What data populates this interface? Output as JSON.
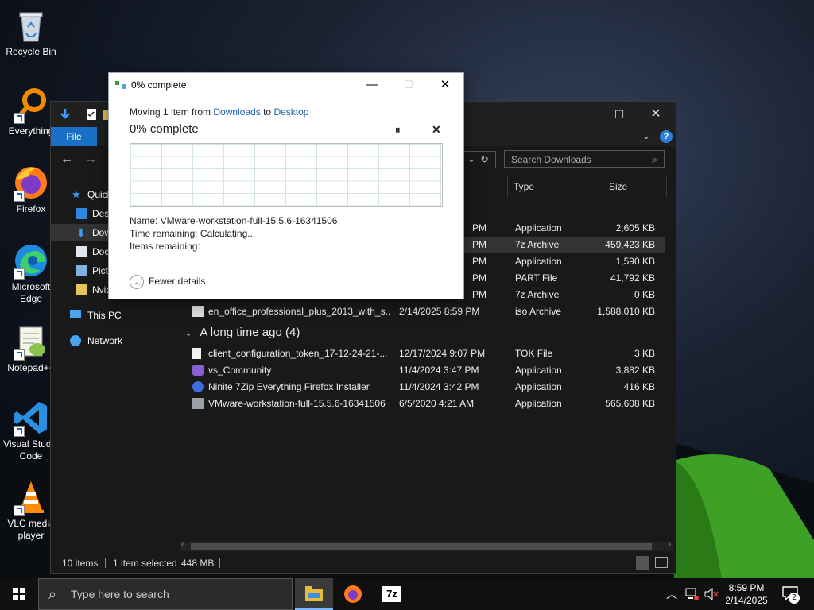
{
  "desktop": {
    "icons": [
      {
        "label": "Recycle Bin",
        "icon": "recycle-bin-icon"
      },
      {
        "label": "Everything",
        "icon": "everything-search-icon"
      },
      {
        "label": "Firefox",
        "icon": "firefox-icon"
      },
      {
        "label": "Microsoft Edge",
        "icon": "edge-icon"
      },
      {
        "label": "Notepad++",
        "icon": "notepad-plus-plus-icon"
      },
      {
        "label": "Visual Studio Code",
        "icon": "vscode-icon"
      },
      {
        "label": "VLC media player",
        "icon": "vlc-icon"
      }
    ]
  },
  "explorer": {
    "file_tab": "File",
    "search_placeholder": "Search Downloads",
    "sidebar": [
      {
        "label": "Quick access",
        "icon": "star-icon"
      },
      {
        "label": "Desktop",
        "icon": "desktop-folder-icon"
      },
      {
        "label": "Downloads",
        "icon": "downloads-folder-icon"
      },
      {
        "label": "Documents",
        "icon": "documents-folder-icon"
      },
      {
        "label": "Pictures",
        "icon": "pictures-folder-icon"
      },
      {
        "label": "Nvidia",
        "icon": "folder-icon"
      },
      {
        "label": "This PC",
        "icon": "this-pc-icon"
      },
      {
        "label": "Network",
        "icon": "network-icon"
      }
    ],
    "columns": {
      "type": "Type",
      "size": "Size"
    },
    "today_rows": [
      {
        "name": "",
        "date": "PM",
        "type": "Application",
        "size": "2,605 KB"
      },
      {
        "name": "",
        "date": "PM",
        "type": "7z Archive",
        "size": "459,423 KB",
        "selected": true
      },
      {
        "name": "",
        "date": "PM",
        "type": "Application",
        "size": "1,590 KB"
      },
      {
        "name": "",
        "date": "PM",
        "type": "PART File",
        "size": "41,792 KB"
      },
      {
        "name": "",
        "date": "PM",
        "type": "7z Archive",
        "size": "0 KB"
      },
      {
        "name": "en_office_professional_plus_2013_with_s...",
        "date": "2/14/2025 8:59 PM",
        "type": "iso Archive",
        "size": "1,588,010 KB"
      }
    ],
    "group_long_ago": "A long time ago (4)",
    "long_ago_rows": [
      {
        "name": "client_configuration_token_17-12-24-21-...",
        "date": "12/17/2024 9:07 PM",
        "type": "TOK File",
        "size": "3 KB"
      },
      {
        "name": "vs_Community",
        "date": "11/4/2024 3:47 PM",
        "type": "Application",
        "size": "3,882 KB"
      },
      {
        "name": "Ninite 7Zip Everything Firefox Installer",
        "date": "11/4/2024 3:42 PM",
        "type": "Application",
        "size": "416 KB"
      },
      {
        "name": "VMware-workstation-full-15.5.6-16341506",
        "date": "6/5/2020 4:21 AM",
        "type": "Application",
        "size": "565,608 KB"
      }
    ],
    "status": {
      "items": "10 items",
      "selected": "1 item selected",
      "size": "448 MB"
    }
  },
  "dialog": {
    "title": "0% complete",
    "moving_prefix": "Moving 1 item from ",
    "source": "Downloads",
    "to": " to ",
    "destination": "Desktop",
    "heading": "0% complete",
    "progress": 0,
    "name_line": "Name:  VMware-workstation-full-15.5.6-16341506",
    "time_line": "Time remaining:  Calculating...",
    "items_line": "Items remaining:",
    "fewer_details": "Fewer details"
  },
  "taskbar": {
    "search_placeholder": "Type here to search",
    "time": "8:59 PM",
    "date": "2/14/2025",
    "notifications": "2",
    "apps": [
      {
        "name": "file-explorer",
        "active": true
      },
      {
        "name": "firefox",
        "active": false
      },
      {
        "name": "7zip",
        "active": false
      }
    ]
  },
  "colors": {
    "accent": "#1a6fc7",
    "link": "#1a5fb4",
    "explorer_bg": "#191919"
  }
}
